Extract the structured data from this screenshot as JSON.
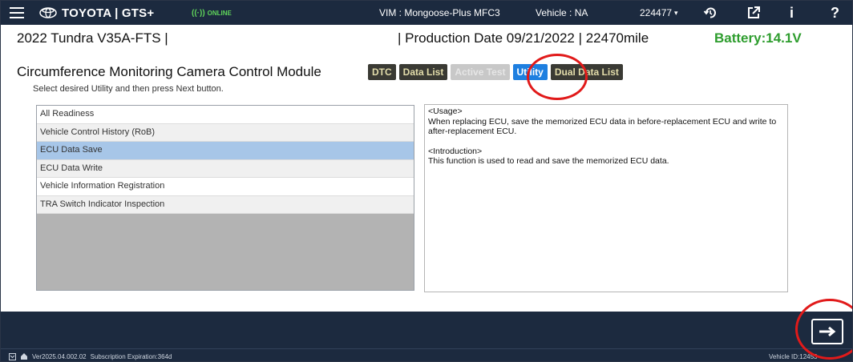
{
  "topbar": {
    "brand": "TOYOTA | GTS+",
    "online": "ONLINE",
    "vim": "VIM : Mongoose-Plus MFC3",
    "vehicle": "Vehicle : NA",
    "code": "224477",
    "info": "i",
    "help": "?"
  },
  "vehicle": {
    "title": "2022 Tundra V35A-FTS  |",
    "production": "|  Production Date 09/21/2022  |  22470mile",
    "battery": "Battery:14.1V"
  },
  "module": {
    "title": "Circumference Monitoring Camera Control Module",
    "instruction": "Select desired Utility and then press Next button."
  },
  "tabs": [
    {
      "label": "DTC",
      "state": "normal"
    },
    {
      "label": "Data List",
      "state": "normal"
    },
    {
      "label": "Active Test",
      "state": "disabled"
    },
    {
      "label": "Utility",
      "state": "active"
    },
    {
      "label": "Dual Data List",
      "state": "normal"
    }
  ],
  "utility_list": [
    "All Readiness",
    "Vehicle Control History (RoB)",
    "ECU Data Save",
    "ECU Data Write",
    "Vehicle Information Registration",
    "TRA Switch Indicator Inspection"
  ],
  "selected_item": "ECU Data Save",
  "description": {
    "usage_header": "<Usage>",
    "usage_text": "When replacing ECU, save the memorized ECU data in before-replacement ECU and write to after-replacement ECU.",
    "intro_header": "<Introduction>",
    "intro_text": "This function is used to read and save the memorized ECU data."
  },
  "status": {
    "version": "Ver2025.04.002.02",
    "subscription": "Subscription Expiration:364d",
    "vehicle_id": "Vehicle ID:12453"
  },
  "colors": {
    "header_bg": "#1c2a3f",
    "accent": "#1e7fe0",
    "battery": "#2e9d2e",
    "annotation": "#e11a1a",
    "selection": "#a7c6e8"
  },
  "icons": [
    "hamburger-icon",
    "toyota-logo-icon",
    "online-signal-icon",
    "history-icon",
    "external-link-icon",
    "info-icon",
    "help-icon",
    "next-arrow-icon",
    "settings-icon",
    "home-icon"
  ]
}
